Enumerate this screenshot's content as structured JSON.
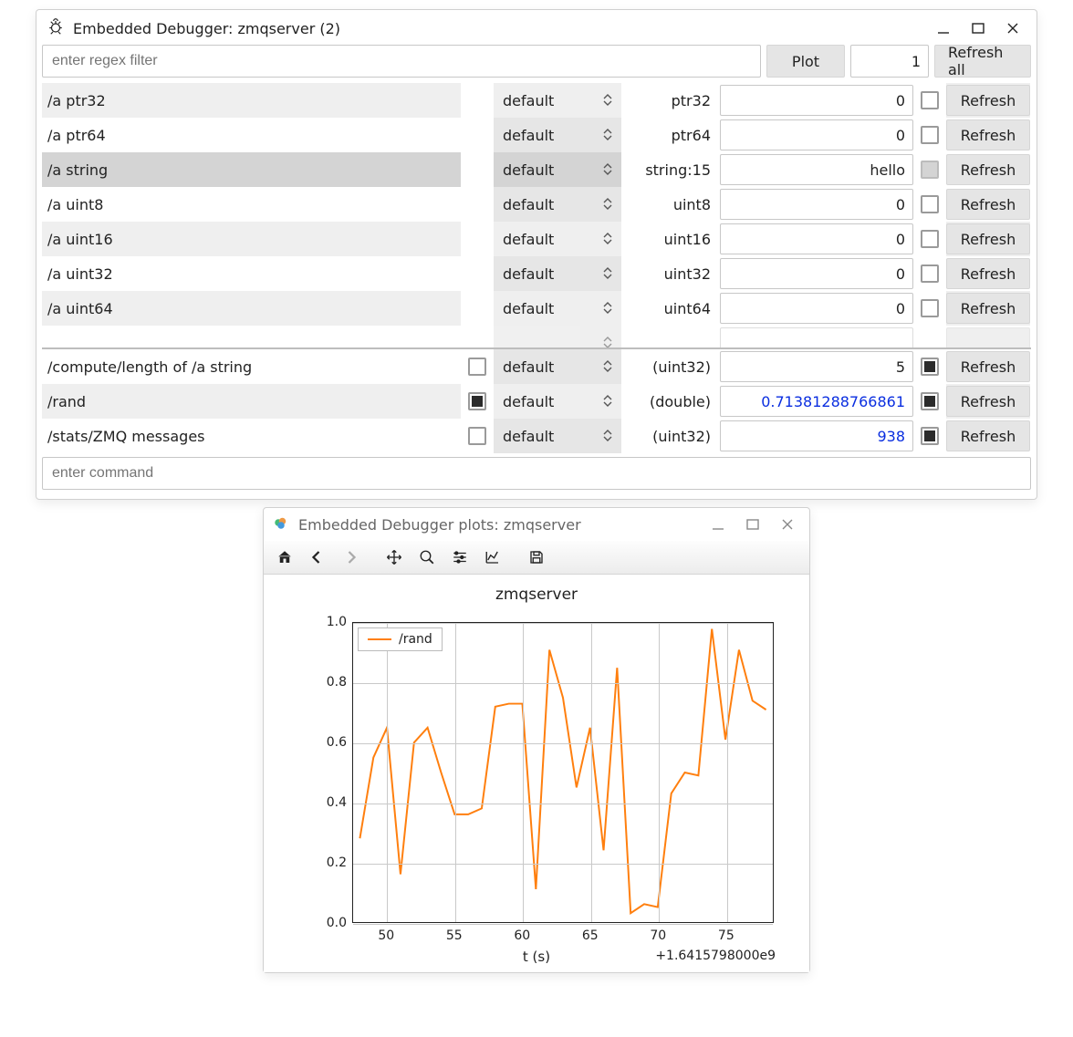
{
  "main_window": {
    "title": "Embedded Debugger: zmqserver (2)",
    "filter_placeholder": "enter regex filter",
    "plot_button": "Plot",
    "refresh_unit": "1",
    "refresh_all": "Refresh all",
    "command_placeholder": "enter command"
  },
  "rows": [
    {
      "name": "/a ptr32",
      "chk1": null,
      "fmt": "default",
      "type": "ptr32",
      "val": "0",
      "chk2": "empty",
      "blue": false,
      "alt": true,
      "sel": false
    },
    {
      "name": "/a ptr64",
      "chk1": null,
      "fmt": "default",
      "type": "ptr64",
      "val": "0",
      "chk2": "empty",
      "blue": false,
      "alt": false,
      "sel": false
    },
    {
      "name": "/a string",
      "chk1": null,
      "fmt": "default",
      "type": "string:15",
      "val": "hello",
      "chk2": "grey",
      "blue": false,
      "alt": false,
      "sel": true
    },
    {
      "name": "/a uint8",
      "chk1": null,
      "fmt": "default",
      "type": "uint8",
      "val": "0",
      "chk2": "empty",
      "blue": false,
      "alt": false,
      "sel": false
    },
    {
      "name": "/a uint16",
      "chk1": null,
      "fmt": "default",
      "type": "uint16",
      "val": "0",
      "chk2": "empty",
      "blue": false,
      "alt": true,
      "sel": false
    },
    {
      "name": "/a uint32",
      "chk1": null,
      "fmt": "default",
      "type": "uint32",
      "val": "0",
      "chk2": "empty",
      "blue": false,
      "alt": false,
      "sel": false
    },
    {
      "name": "/a uint64",
      "chk1": null,
      "fmt": "default",
      "type": "uint64",
      "val": "0",
      "chk2": "empty",
      "blue": false,
      "alt": true,
      "sel": false
    }
  ],
  "rows_bottom": [
    {
      "name": "/compute/length of /a string",
      "chk1": "empty",
      "fmt": "default",
      "type": "(uint32)",
      "val": "5",
      "chk2": "black",
      "blue": false,
      "alt": false
    },
    {
      "name": "/rand",
      "chk1": "black",
      "fmt": "default",
      "type": "(double)",
      "val": "0.71381288766861",
      "chk2": "black",
      "blue": true,
      "alt": true
    },
    {
      "name": "/stats/ZMQ messages",
      "chk1": "empty",
      "fmt": "default",
      "type": "(uint32)",
      "val": "938",
      "chk2": "black",
      "blue": true,
      "alt": false
    }
  ],
  "refresh_label": "Refresh",
  "plot_window": {
    "title": "Embedded Debugger plots: zmqserver"
  },
  "chart_data": {
    "type": "line",
    "title": "zmqserver",
    "xlabel": "t (s)",
    "ylabel": "",
    "x_offset_label": "+1.6415798000e9",
    "series": [
      {
        "name": "/rand",
        "x": [
          48,
          49,
          50,
          51,
          52,
          53,
          54,
          55,
          56,
          57,
          58,
          59,
          60,
          61,
          62,
          63,
          64,
          65,
          66,
          67,
          68,
          69,
          70,
          71,
          72,
          73,
          74,
          75,
          76,
          77,
          78
        ],
        "y": [
          0.28,
          0.55,
          0.65,
          0.16,
          0.6,
          0.65,
          0.5,
          0.36,
          0.36,
          0.38,
          0.72,
          0.73,
          0.73,
          0.11,
          0.91,
          0.75,
          0.45,
          0.65,
          0.24,
          0.85,
          0.03,
          0.06,
          0.05,
          0.43,
          0.5,
          0.49,
          0.98,
          0.61,
          0.91,
          0.74,
          0.71
        ]
      }
    ],
    "xticks": [
      50,
      55,
      60,
      65,
      70,
      75
    ],
    "yticks": [
      0.0,
      0.2,
      0.4,
      0.6,
      0.8,
      1.0
    ],
    "xlim": [
      47.5,
      78.5
    ],
    "ylim": [
      0.0,
      1.0
    ]
  }
}
